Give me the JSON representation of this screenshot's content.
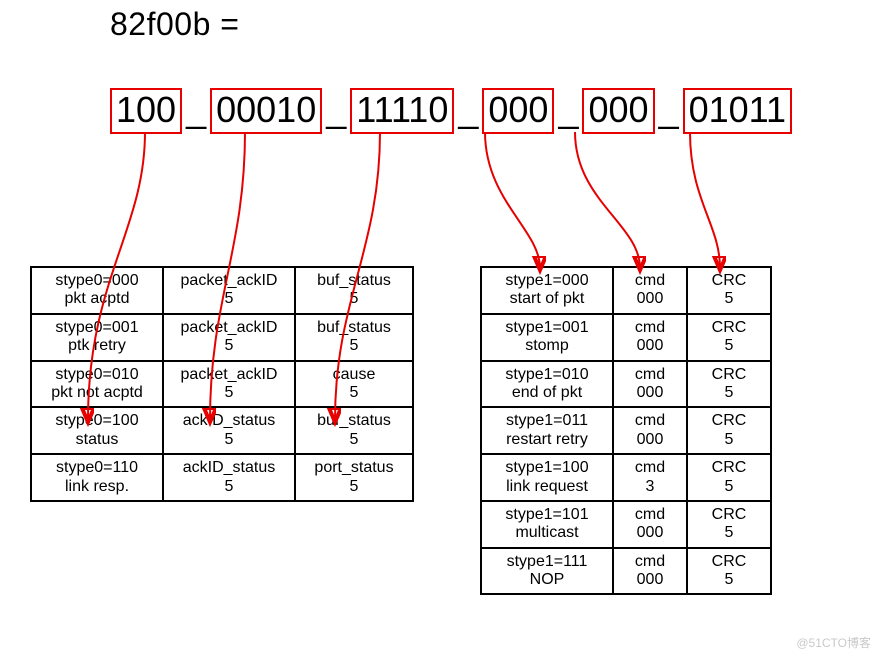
{
  "hex_equation": "82f00b =",
  "binary_groups": [
    "100",
    "00010",
    "11110",
    "000",
    "000",
    "01011"
  ],
  "separator": "_",
  "left_table": {
    "rows": [
      {
        "c1a": "stype0=000",
        "c1b": "pkt acptd",
        "c2a": "packet_ackID",
        "c2b": "5",
        "c3a": "buf_status",
        "c3b": "5"
      },
      {
        "c1a": "stype0=001",
        "c1b": "ptk retry",
        "c2a": "packet_ackID",
        "c2b": "5",
        "c3a": "buf_status",
        "c3b": "5"
      },
      {
        "c1a": "stype0=010",
        "c1b": "pkt not acptd",
        "c2a": "packet_ackID",
        "c2b": "5",
        "c3a": "cause",
        "c3b": "5"
      },
      {
        "c1a": "stype0=100",
        "c1b": "status",
        "c2a": "ackID_status",
        "c2b": "5",
        "c3a": "buf_status",
        "c3b": "5"
      },
      {
        "c1a": "stype0=110",
        "c1b": "link resp.",
        "c2a": "ackID_status",
        "c2b": "5",
        "c3a": "port_status",
        "c3b": "5"
      }
    ]
  },
  "right_table": {
    "rows": [
      {
        "c1a": "stype1=000",
        "c1b": "start of pkt",
        "c2a": "cmd",
        "c2b": "000",
        "c3a": "CRC",
        "c3b": "5"
      },
      {
        "c1a": "stype1=001",
        "c1b": "stomp",
        "c2a": "cmd",
        "c2b": "000",
        "c3a": "CRC",
        "c3b": "5"
      },
      {
        "c1a": "stype1=010",
        "c1b": "end of pkt",
        "c2a": "cmd",
        "c2b": "000",
        "c3a": "CRC",
        "c3b": "5"
      },
      {
        "c1a": "stype1=011",
        "c1b": "restart retry",
        "c2a": "cmd",
        "c2b": "000",
        "c3a": "CRC",
        "c3b": "5"
      },
      {
        "c1a": "stype1=100",
        "c1b": "link request",
        "c2a": "cmd",
        "c2b": "3",
        "c3a": "CRC",
        "c3b": "5"
      },
      {
        "c1a": "stype1=101",
        "c1b": "multicast",
        "c2a": "cmd",
        "c2b": "000",
        "c3a": "CRC",
        "c3b": "5"
      },
      {
        "c1a": "stype1=111",
        "c1b": "NOP",
        "c2a": "cmd",
        "c2b": "000",
        "c3a": "CRC",
        "c3b": "5"
      }
    ]
  },
  "watermark": "@51CTO博客"
}
